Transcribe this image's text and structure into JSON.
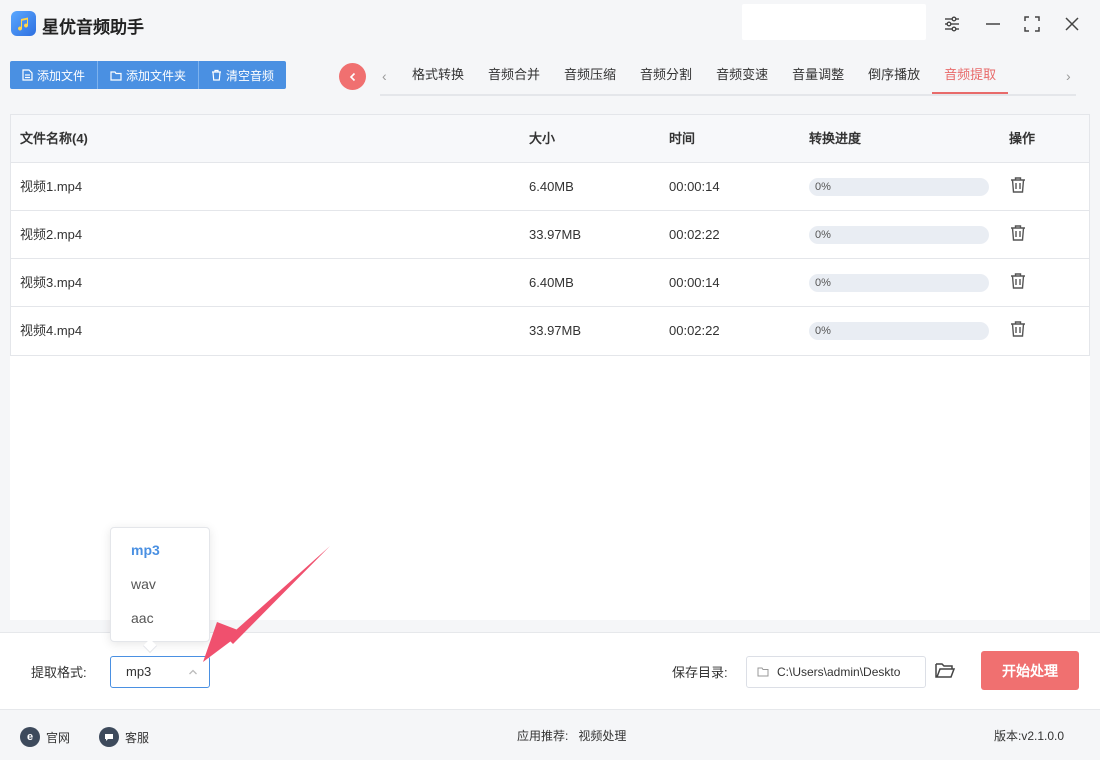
{
  "app": {
    "title": "星优音频助手",
    "accent": "#4a90e2",
    "danger": "#f07070"
  },
  "toolbar": {
    "add_file": "添加文件",
    "add_folder": "添加文件夹",
    "clear": "清空音频"
  },
  "tabs": [
    {
      "label": "格式转换",
      "active": false
    },
    {
      "label": "音频合并",
      "active": false
    },
    {
      "label": "音频压缩",
      "active": false
    },
    {
      "label": "音频分割",
      "active": false
    },
    {
      "label": "音频变速",
      "active": false
    },
    {
      "label": "音量调整",
      "active": false
    },
    {
      "label": "倒序播放",
      "active": false
    },
    {
      "label": "音频提取",
      "active": true
    }
  ],
  "table": {
    "headers": {
      "name": "文件名称(4)",
      "size": "大小",
      "time": "时间",
      "progress": "转换进度",
      "op": "操作"
    },
    "rows": [
      {
        "name": "视频1.mp4",
        "size": "6.40MB",
        "time": "00:00:14",
        "progress": "0%",
        "progress_value": 0
      },
      {
        "name": "视频2.mp4",
        "size": "33.97MB",
        "time": "00:02:22",
        "progress": "0%",
        "progress_value": 0
      },
      {
        "name": "视频3.mp4",
        "size": "6.40MB",
        "time": "00:00:14",
        "progress": "0%",
        "progress_value": 0
      },
      {
        "name": "视频4.mp4",
        "size": "33.97MB",
        "time": "00:02:22",
        "progress": "0%",
        "progress_value": 0
      }
    ]
  },
  "settings": {
    "format_label": "提取格式:",
    "format_value": "mp3",
    "format_options": [
      "mp3",
      "wav",
      "aac"
    ],
    "save_label": "保存目录:",
    "save_path": "C:\\Users\\admin\\Deskto",
    "start_button": "开始处理"
  },
  "footer": {
    "website": "官网",
    "support": "客服",
    "recommend_label": "应用推荐:",
    "recommend_app": "视频处理",
    "version": "版本:v2.1.0.0"
  }
}
